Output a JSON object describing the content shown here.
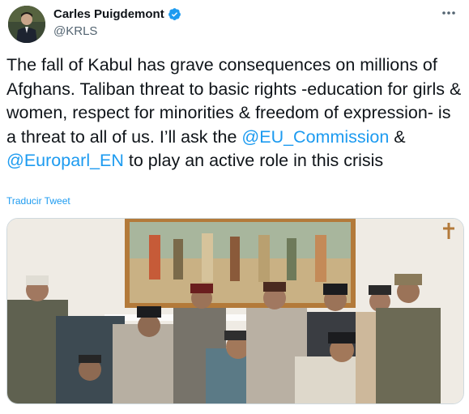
{
  "author": {
    "display_name": "Carles Puigdemont",
    "handle": "@KRLS",
    "verified": true,
    "avatar_icon": "profile-photo"
  },
  "tweet": {
    "text_part1": "The fall of Kabul has grave consequences on millions of Afghans. Taliban threat to basic rights -education for girls & women, respect for minorities & freedom of expression- is a threat to all of us. I’ll ask the ",
    "mention1": "@EU_Commission",
    "text_part2": " & ",
    "mention2": "@Europarl_EN",
    "text_part3": " to play an active role in this crisis",
    "translate_label": "Traducir Tweet"
  },
  "more_icon": "more-dots-icon",
  "colors": {
    "link": "#1d9bf0",
    "text": "#0f1419",
    "secondary": "#536471",
    "verified": "#1d9bf0"
  }
}
